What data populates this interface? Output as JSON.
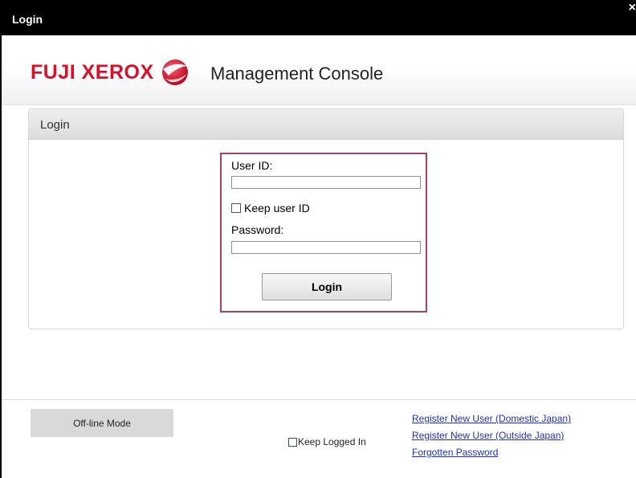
{
  "window": {
    "title": "Login",
    "close_glyph": "×"
  },
  "header": {
    "brand": "FUJI XEROX",
    "app_title": "Management Console",
    "brand_color": "#d8102a"
  },
  "panel": {
    "title": "Login"
  },
  "form": {
    "user_id_label": "User ID:",
    "user_id_value": "",
    "keep_user_id_label": "Keep user ID",
    "keep_user_id_checked": false,
    "password_label": "Password:",
    "password_value": "",
    "login_button": "Login",
    "highlight_color": "#a2416e"
  },
  "footer": {
    "offline_button": "Off-line Mode",
    "keep_logged_in_label": "Keep Logged In",
    "keep_logged_in_checked": false,
    "links": [
      "Register New User (Domestic Japan)",
      "Register New User (Outside Japan)",
      "Forgotten Password"
    ]
  }
}
